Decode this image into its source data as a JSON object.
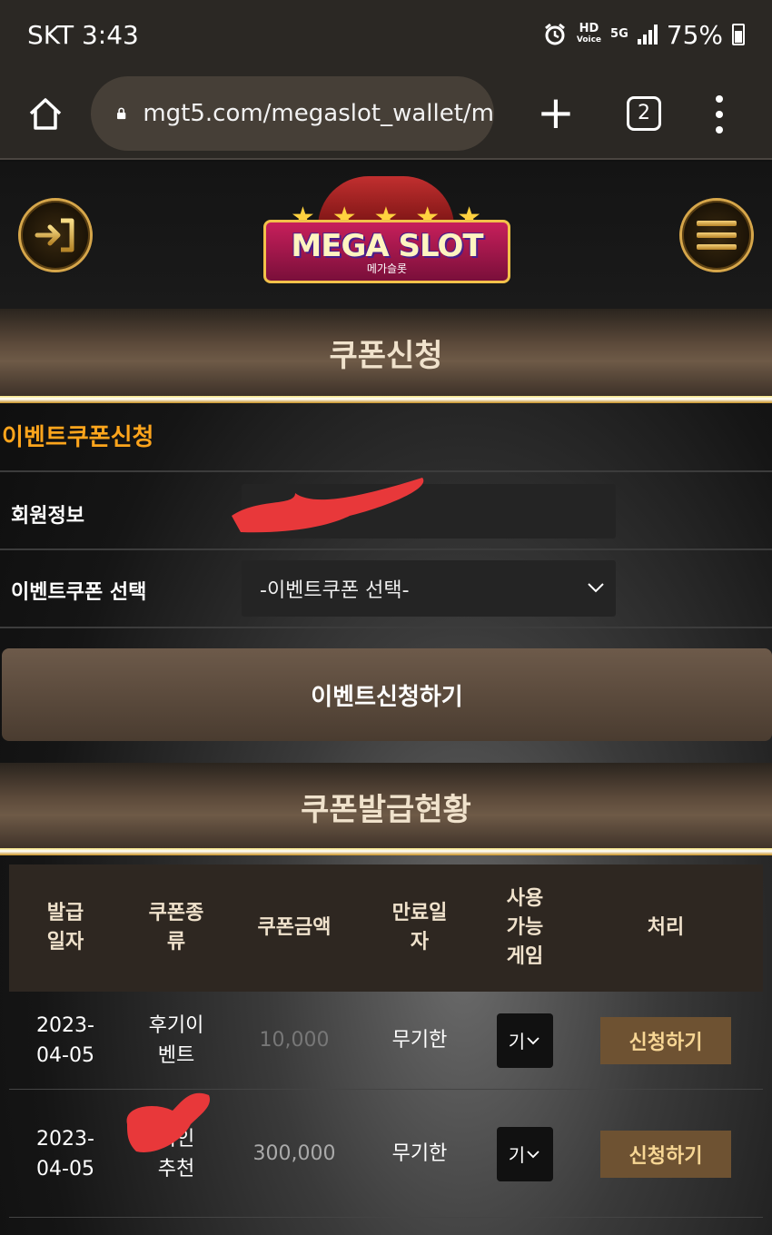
{
  "status_bar": {
    "carrier_time": "SKT 3:43",
    "hd_label": "HD",
    "voice_label": "Voice",
    "network_label": "5G",
    "battery": "75%",
    "icons": [
      "alarm-icon",
      "signal-icon",
      "battery-icon"
    ]
  },
  "browser": {
    "url": "mgt5.com/megaslot_wallet/m",
    "tab_count": "2",
    "icons": [
      "home-icon",
      "lock-icon",
      "plus-icon",
      "tabs-icon",
      "more-icon"
    ]
  },
  "site": {
    "logo_text": "MEGA SLOT",
    "logo_sub": "메가슬롯",
    "colors": {
      "accent_orange": "#ffa51c",
      "gold": "#d6a64a",
      "button_brown": "#6e5232"
    }
  },
  "coupon_apply": {
    "title": "쿠폰신청",
    "event_title": "이벤트쿠폰신청",
    "member_label": "회원정보",
    "member_value": "",
    "select_label": "이벤트쿠폰 선택",
    "select_value": "-이벤트쿠폰 선택-",
    "submit_label": "이벤트신청하기"
  },
  "coupon_status": {
    "title": "쿠폰발급현황",
    "headers": {
      "issue_date": "발급일자",
      "type": "쿠폰종류",
      "amount": "쿠폰금액",
      "expire": "만료일자",
      "games": "사용가능게임",
      "action": "처리"
    },
    "rows": [
      {
        "issue_date": "2023-04-05",
        "type": "후기이벤트",
        "amount": "10,000",
        "expire": "무기한",
        "game_select": "기",
        "action": "신청하기"
      },
      {
        "issue_date": "2023-04-05",
        "type": "지인추천",
        "amount": "300,000",
        "expire": "무기한",
        "game_select": "기",
        "action": "신청하기"
      }
    ]
  }
}
